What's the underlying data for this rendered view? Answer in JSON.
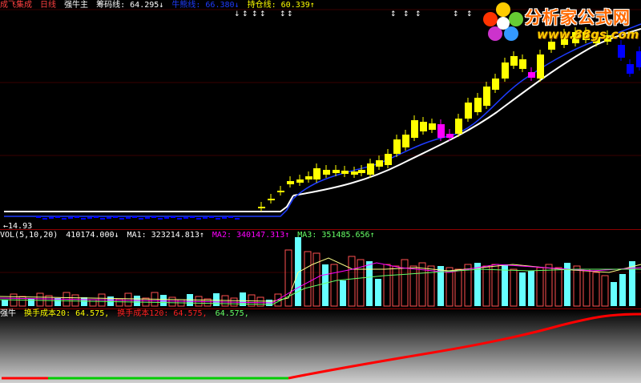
{
  "main_header": {
    "name": "成飞集成",
    "period": "日线",
    "indicator": "强牛主",
    "line1_label": "筹码线:",
    "line1_value": "64.295↓",
    "line2_label": "牛熊线:",
    "line2_value": "66.380↓",
    "line3_label": "持仓线:",
    "line3_value": "60.339↑"
  },
  "price_low_label": "←14.93",
  "vol_header": {
    "label": "VOL(5,10,20)",
    "vol": "410174.000↓",
    "ma1": "MA1: 323214.813↑",
    "ma2": "MA2: 340147.313↑",
    "ma3": "MA3: 351485.656↑"
  },
  "bottom_header": {
    "label": "强牛",
    "item1": "换手成本20: 64.575,",
    "item2": "换手成本120: 64.575,",
    "item3": "64.575,"
  },
  "logo": {
    "brand": "分析家公式网",
    "url": "www.88gs.com"
  },
  "colors": {
    "up_candle": "#ffff00",
    "down_candle": "#0000ff",
    "magenta_candle": "#ff00ff",
    "white_line": "#ffffff",
    "blue_line": "#1e3cff",
    "vol_up": "#ff5050",
    "vol_down": "#66ffff",
    "cost_red": "#ff0000",
    "cost_green": "#00cc00",
    "pane_border": "#8b0000"
  }
}
